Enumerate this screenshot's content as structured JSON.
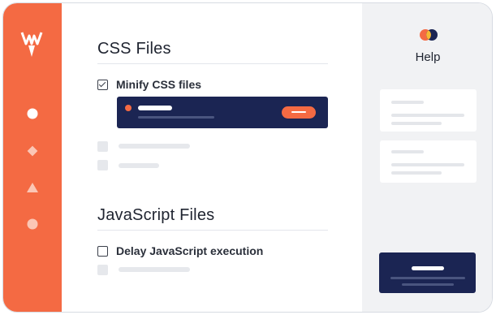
{
  "brand": {
    "logo_icon": "wp-rocket-logo-icon",
    "accent": "#f46a43",
    "navy": "#1b2553"
  },
  "sidebar": {
    "items": [
      {
        "icon": "circle-icon"
      },
      {
        "icon": "diamond-icon"
      },
      {
        "icon": "triangle-icon"
      },
      {
        "icon": "circle-icon"
      }
    ]
  },
  "sections": {
    "css": {
      "title": "CSS Files",
      "option": {
        "label": "Minify CSS files",
        "checked": true
      }
    },
    "js": {
      "title": "JavaScript Files",
      "option": {
        "label": "Delay JavaScript execution",
        "checked": false
      }
    }
  },
  "help": {
    "title": "Help",
    "icon": "help-logo-icon"
  }
}
